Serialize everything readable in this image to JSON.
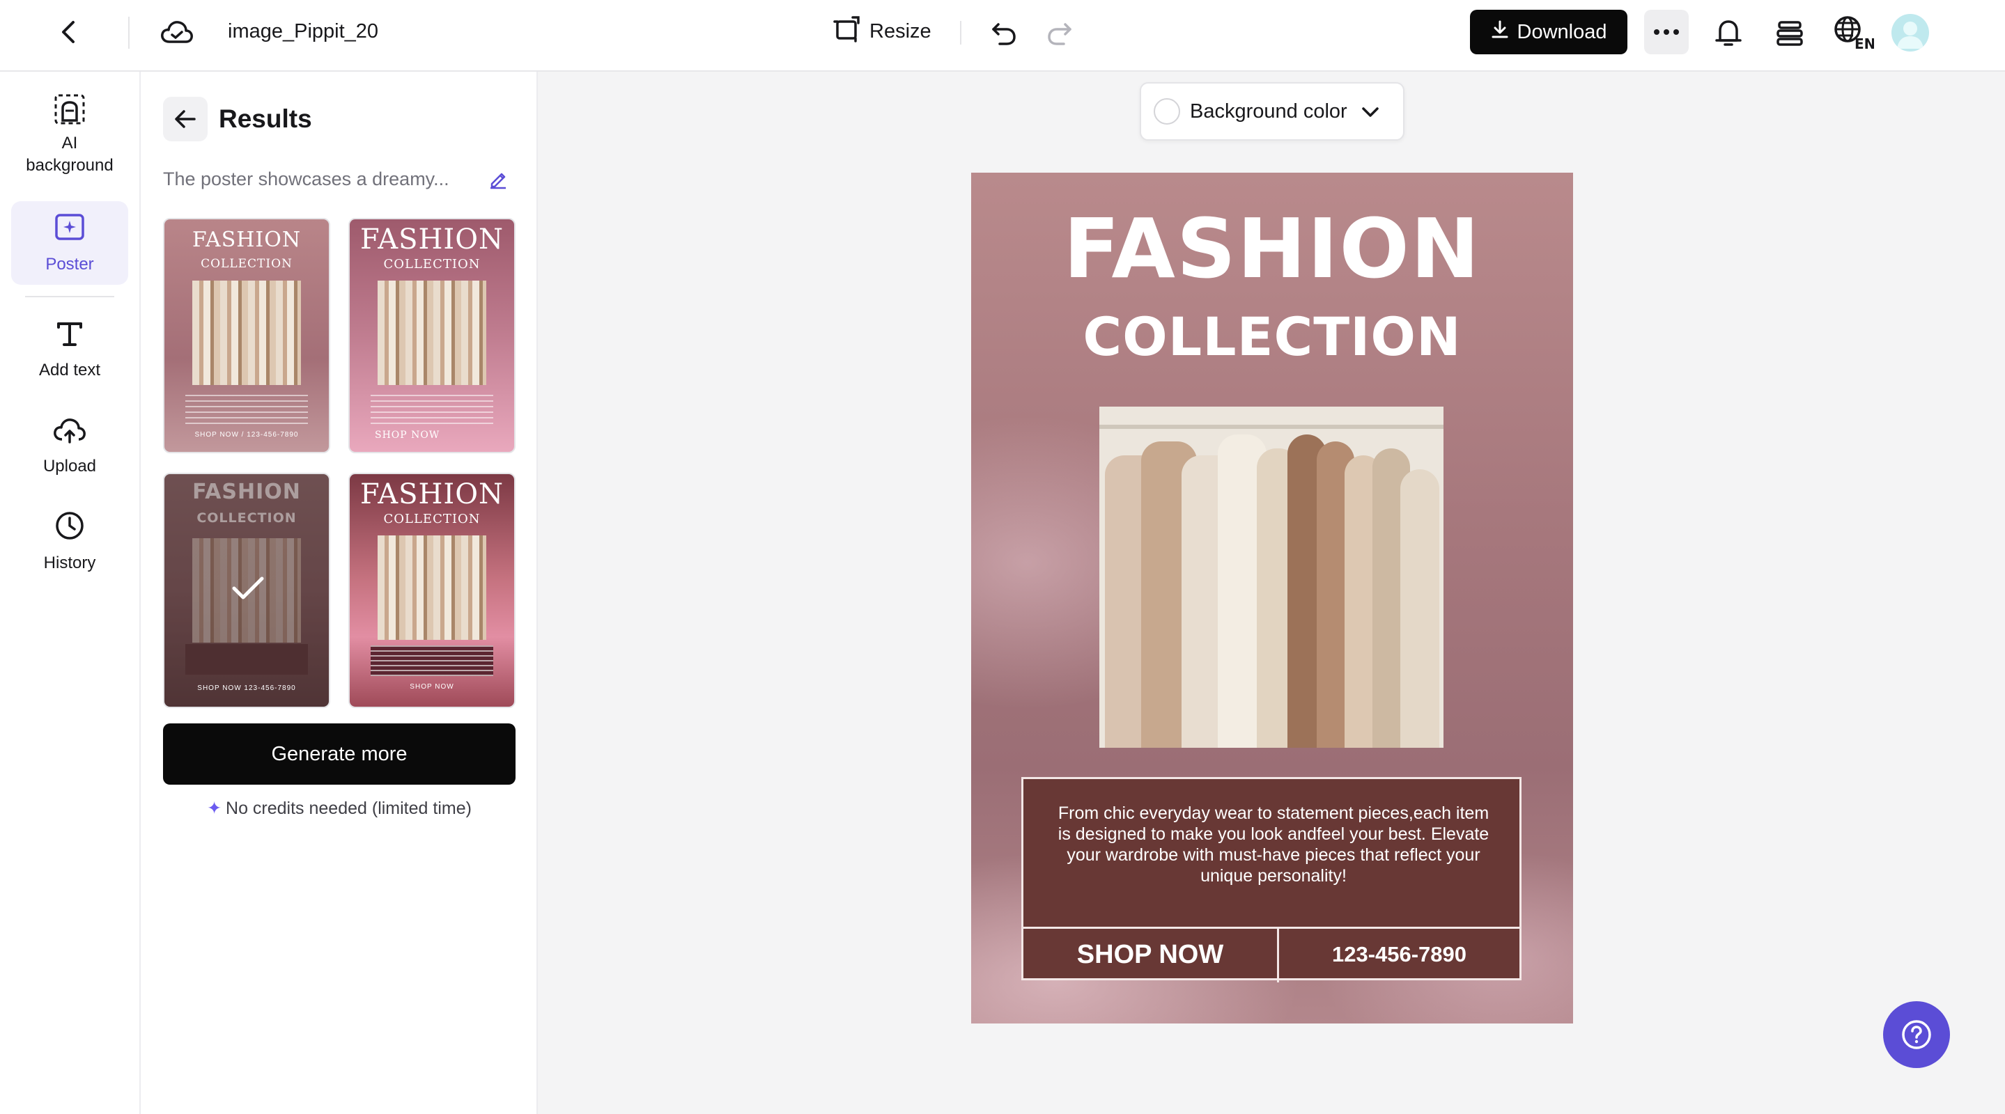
{
  "header": {
    "project_name": "image_Pippit_20",
    "resize_label": "Resize",
    "download_label": "Download"
  },
  "rail": {
    "items": [
      {
        "label": "AI background",
        "icon": "ai-background-icon"
      },
      {
        "label": "Poster",
        "icon": "poster-icon",
        "active": true
      },
      {
        "label": "Add text",
        "icon": "text-icon"
      },
      {
        "label": "Upload",
        "icon": "upload-icon"
      },
      {
        "label": "History",
        "icon": "history-icon"
      }
    ]
  },
  "panel": {
    "title": "Results",
    "prompt": "The poster showcases a dreamy...",
    "thumbnails": [
      {
        "title": "FASHION",
        "subtitle": "COLLECTION",
        "cta": "SHOP NOW / 123-456-7890"
      },
      {
        "title": "FASHION",
        "subtitle": "COLLECTION",
        "cta": "SHOP NOW"
      },
      {
        "title": "FASHION",
        "subtitle": "COLLECTION",
        "cta": "SHOP NOW   123-456-7890",
        "selected": true
      },
      {
        "title": "FASHION",
        "subtitle": "COLLECTION",
        "cta": "SHOP NOW"
      }
    ],
    "generate_label": "Generate more",
    "credits_note": "No credits needed (limited time)"
  },
  "canvas": {
    "background_color_label": "Background color",
    "poster": {
      "title": "FASHION",
      "subtitle": "COLLECTION",
      "description": "From chic everyday wear to statement pieces,each item is designed to make you look andfeel your best. Elevate your wardrobe with must-have pieces that reflect your unique personality!",
      "cta": "SHOP NOW",
      "phone": "123-456-7890"
    }
  },
  "colors": {
    "accent": "#5b4dd6",
    "download_bg": "#0a0a0a",
    "poster_box": "#683835"
  }
}
